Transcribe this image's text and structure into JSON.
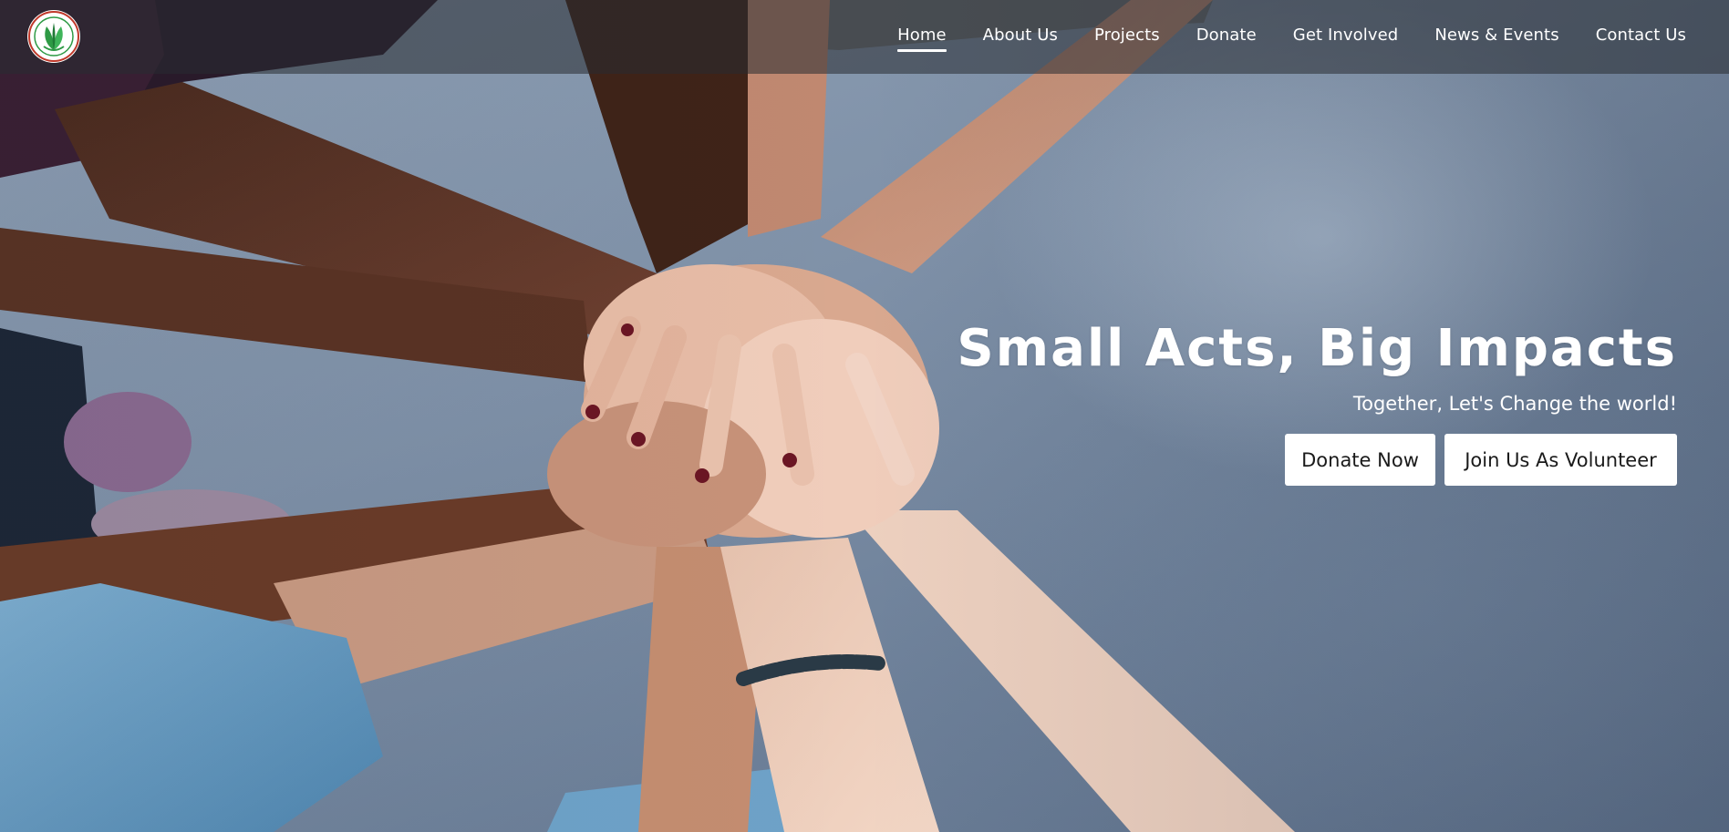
{
  "brand": {
    "logo_name": "Leaf logo emblem",
    "accent_green": "#2e9a45",
    "accent_red": "#c0392b"
  },
  "nav": {
    "items": [
      {
        "label": "Home",
        "active": true
      },
      {
        "label": "About Us",
        "active": false
      },
      {
        "label": "Projects",
        "active": false
      },
      {
        "label": "Donate",
        "active": false
      },
      {
        "label": "Get Involved",
        "active": false
      },
      {
        "label": "News & Events",
        "active": false
      },
      {
        "label": "Contact Us",
        "active": false
      }
    ]
  },
  "hero": {
    "image_name": "stacked-hands-photo",
    "title": "Small Acts, Big Impacts",
    "subtitle": "Together, Let's Change the world!",
    "buttons": {
      "donate": "Donate Now",
      "volunteer": "Join Us As Volunteer"
    }
  }
}
